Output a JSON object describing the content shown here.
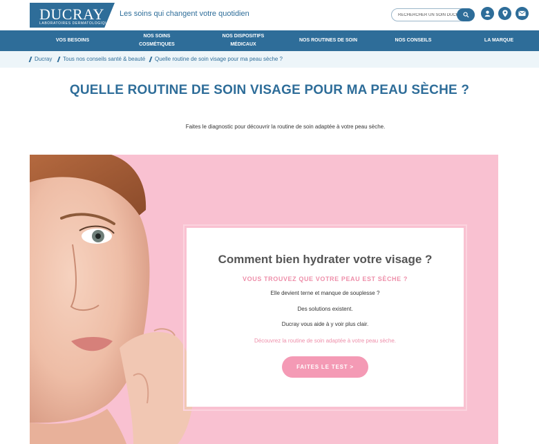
{
  "brand": {
    "name": "DUCRAY",
    "subtitle": "LABORATOIRES DERMATOLOGIQUES",
    "tagline": "Les soins qui changent votre quotidien"
  },
  "search": {
    "placeholder": "RECHERCHER UN SOIN DUCRAY"
  },
  "header_icons": [
    "search-icon",
    "account-icon",
    "location-icon",
    "mail-icon"
  ],
  "nav": {
    "items": [
      {
        "label": "VOS BESOINS"
      },
      {
        "label": "NOS SOINS\nCOSMÉTIQUES"
      },
      {
        "label": "NOS DISPOSITIFS\nMÉDICAUX"
      },
      {
        "label": "NOS ROUTINES DE SOIN"
      },
      {
        "label": "NOS CONSEILS"
      },
      {
        "label": "LA MARQUE"
      }
    ]
  },
  "breadcrumb": [
    "Ducray",
    "Tous nos conseils santé & beauté",
    "Quelle routine de soin visage pour ma peau sèche ?"
  ],
  "page": {
    "title": "QUELLE ROUTINE DE SOIN VISAGE POUR MA PEAU SÈCHE ?",
    "intro": "Faites le diagnostic pour découvrir la routine de soin adaptée à votre peau sèche."
  },
  "card": {
    "title": "Comment bien hydrater votre visage ?",
    "subtitle": "VOUS TROUVEZ QUE VOTRE PEAU EST SÈCHE ?",
    "lines": [
      "Elle devient terne et manque de souplesse ?",
      "Des solutions existent.",
      "Ducray vous aide à y voir plus clair."
    ],
    "link": "Découvrez la routine de soin adaptée à votre peau sèche.",
    "cta": "FAITES LE TEST >"
  },
  "colors": {
    "brand_blue": "#2e6d99",
    "pink_bg": "#f9c1d1",
    "pink_accent": "#ee8faa",
    "cta_pink": "#f49ab5",
    "breadcrumb_bg": "#edf5f9"
  }
}
